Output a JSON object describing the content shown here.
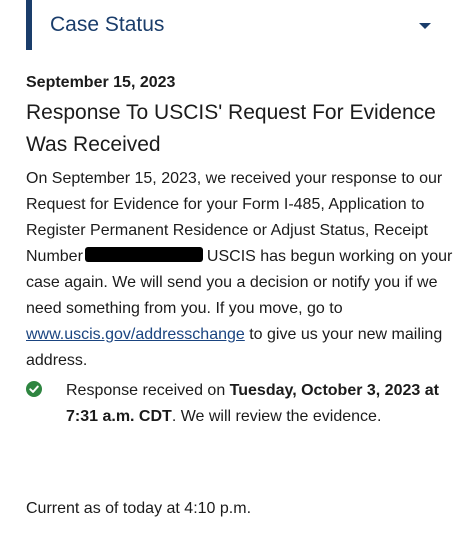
{
  "header": {
    "title": "Case Status",
    "toggle_icon": "chevron-down-icon",
    "accent_color": "#1a3d6b"
  },
  "status": {
    "date": "September 15, 2023",
    "heading": "Response To USCIS' Request For Evidence Was Received",
    "body_part1": "On September 15, 2023, we received your response to our Request for Evidence for your Form I-485, Application to Register Permanent Residence or Adjust Status, Receipt Number",
    "body_part2": "USCIS has begun working on your case again. We will send you a decision or notify you if we need something from you. If you move, go to",
    "link_text": "www.uscis.gov/addresschange",
    "body_part3": "to give us your new mailing address."
  },
  "event": {
    "icon": "check-circle-icon",
    "icon_color": "#2e8540",
    "prefix": "Response received on",
    "date_bold": "Tuesday, October 3, 2023 at 7:31 a.m. CDT",
    "suffix": ". We will review the evidence."
  },
  "footer": {
    "current_as_of": "Current as of today at 4:10 p.m."
  }
}
